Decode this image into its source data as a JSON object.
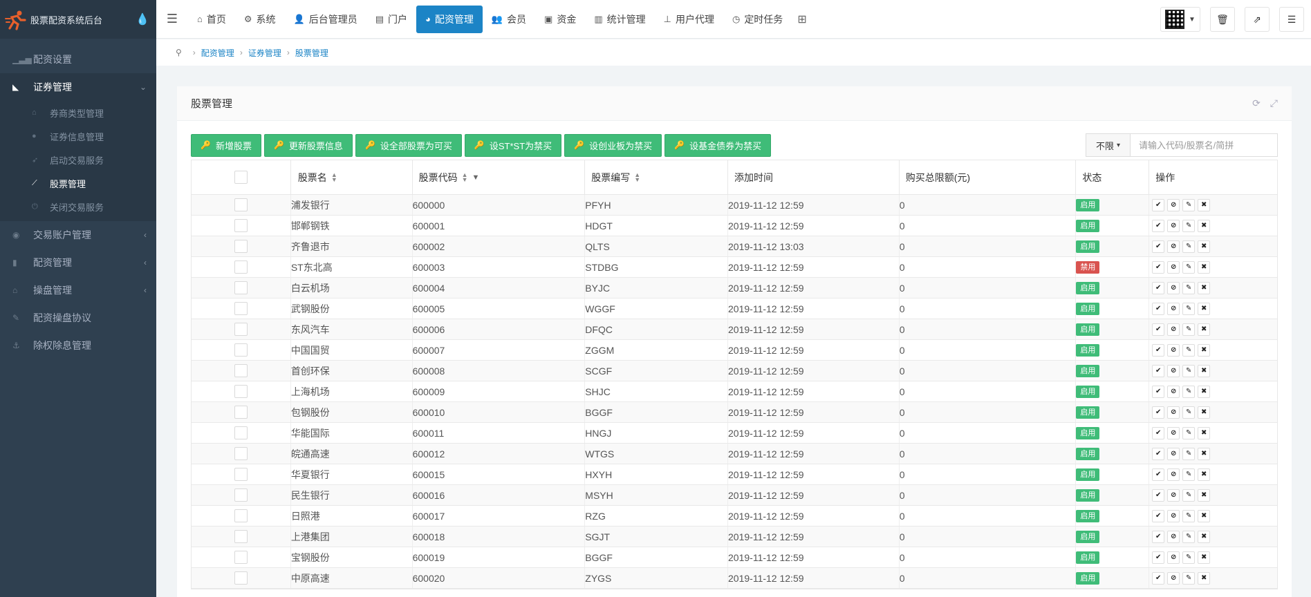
{
  "brand": {
    "title": "股票配资系统后台"
  },
  "sidebar": {
    "items": [
      {
        "label": "配资设置",
        "icon": "bar-chart-icon",
        "glyph": "▁▃▅"
      },
      {
        "label": "证券管理",
        "icon": "area-chart-icon",
        "glyph": "◣"
      },
      {
        "label": "交易账户管理",
        "icon": "user-circle-icon",
        "glyph": "◉"
      },
      {
        "label": "配资管理",
        "icon": "thermometer-icon",
        "glyph": "▮"
      },
      {
        "label": "操盘管理",
        "icon": "bank-icon",
        "glyph": "⌂"
      },
      {
        "label": "配资操盘协议",
        "icon": "pencil-icon",
        "glyph": "✎"
      },
      {
        "label": "除权除息管理",
        "icon": "anchor-icon",
        "glyph": "⚓"
      }
    ],
    "submenu": [
      {
        "label": "券商类型管理",
        "icon": "bank-icon",
        "glyph": "⌂"
      },
      {
        "label": "证券信息管理",
        "icon": "user-icon",
        "glyph": "●"
      },
      {
        "label": "启动交易服务",
        "icon": "rocket-icon",
        "glyph": "➶"
      },
      {
        "label": "股票管理",
        "icon": "line-chart-icon",
        "glyph": "⟋"
      },
      {
        "label": "关闭交易服务",
        "icon": "power-icon",
        "glyph": "⏻"
      }
    ]
  },
  "nav": {
    "tabs": [
      {
        "label": "首页",
        "icon": "home-icon",
        "glyph": "⌂"
      },
      {
        "label": "系统",
        "icon": "gear-icon",
        "glyph": "⚙"
      },
      {
        "label": "后台管理员",
        "icon": "user-icon",
        "glyph": "👤"
      },
      {
        "label": "门户",
        "icon": "newspaper-icon",
        "glyph": "▤"
      },
      {
        "label": "配资管理",
        "icon": "pie-chart-icon",
        "glyph": "◕"
      },
      {
        "label": "会员",
        "icon": "users-icon",
        "glyph": "👥"
      },
      {
        "label": "资金",
        "icon": "money-icon",
        "glyph": "▣"
      },
      {
        "label": "统计管理",
        "icon": "bar-chart-icon",
        "glyph": "▥"
      },
      {
        "label": "用户代理",
        "icon": "sitemap-icon",
        "glyph": "⊥"
      },
      {
        "label": "定时任务",
        "icon": "clock-icon",
        "glyph": "◷"
      }
    ]
  },
  "breadcrumb": {
    "items": [
      "配资管理",
      "证券管理",
      "股票管理"
    ]
  },
  "panel": {
    "title": "股票管理"
  },
  "toolbar": {
    "buttons": [
      "新增股票",
      "更新股票信息",
      "设全部股票为可买",
      "设ST*ST为禁买",
      "设创业板为禁买",
      "设基金债券为禁买"
    ],
    "filter_label": "不限",
    "search_placeholder": "请输入代码/股票名/简拼"
  },
  "table": {
    "headers": {
      "name": "股票名",
      "code": "股票代码",
      "abbr": "股票编写",
      "time": "添加时间",
      "limit": "购买总限额(元)",
      "status": "状态",
      "ops": "操作"
    },
    "rows": [
      {
        "name": "浦发银行",
        "code": "600000",
        "abbr": "PFYH",
        "time": "2019-11-12 12:59",
        "limit": "0",
        "status": "启用",
        "status_on": true
      },
      {
        "name": "邯郸钢铁",
        "code": "600001",
        "abbr": "HDGT",
        "time": "2019-11-12 12:59",
        "limit": "0",
        "status": "启用",
        "status_on": true
      },
      {
        "name": "齐鲁退市",
        "code": "600002",
        "abbr": "QLTS",
        "time": "2019-11-12 13:03",
        "limit": "0",
        "status": "启用",
        "status_on": true
      },
      {
        "name": "ST东北高",
        "code": "600003",
        "abbr": "STDBG",
        "time": "2019-11-12 12:59",
        "limit": "0",
        "status": "禁用",
        "status_on": false
      },
      {
        "name": "白云机场",
        "code": "600004",
        "abbr": "BYJC",
        "time": "2019-11-12 12:59",
        "limit": "0",
        "status": "启用",
        "status_on": true
      },
      {
        "name": "武钢股份",
        "code": "600005",
        "abbr": "WGGF",
        "time": "2019-11-12 12:59",
        "limit": "0",
        "status": "启用",
        "status_on": true
      },
      {
        "name": "东风汽车",
        "code": "600006",
        "abbr": "DFQC",
        "time": "2019-11-12 12:59",
        "limit": "0",
        "status": "启用",
        "status_on": true
      },
      {
        "name": "中国国贸",
        "code": "600007",
        "abbr": "ZGGM",
        "time": "2019-11-12 12:59",
        "limit": "0",
        "status": "启用",
        "status_on": true
      },
      {
        "name": "首创环保",
        "code": "600008",
        "abbr": "SCGF",
        "time": "2019-11-12 12:59",
        "limit": "0",
        "status": "启用",
        "status_on": true
      },
      {
        "name": "上海机场",
        "code": "600009",
        "abbr": "SHJC",
        "time": "2019-11-12 12:59",
        "limit": "0",
        "status": "启用",
        "status_on": true
      },
      {
        "name": "包钢股份",
        "code": "600010",
        "abbr": "BGGF",
        "time": "2019-11-12 12:59",
        "limit": "0",
        "status": "启用",
        "status_on": true
      },
      {
        "name": "华能国际",
        "code": "600011",
        "abbr": "HNGJ",
        "time": "2019-11-12 12:59",
        "limit": "0",
        "status": "启用",
        "status_on": true
      },
      {
        "name": "皖通高速",
        "code": "600012",
        "abbr": "WTGS",
        "time": "2019-11-12 12:59",
        "limit": "0",
        "status": "启用",
        "status_on": true
      },
      {
        "name": "华夏银行",
        "code": "600015",
        "abbr": "HXYH",
        "time": "2019-11-12 12:59",
        "limit": "0",
        "status": "启用",
        "status_on": true
      },
      {
        "name": "民生银行",
        "code": "600016",
        "abbr": "MSYH",
        "time": "2019-11-12 12:59",
        "limit": "0",
        "status": "启用",
        "status_on": true
      },
      {
        "name": "日照港",
        "code": "600017",
        "abbr": "RZG",
        "time": "2019-11-12 12:59",
        "limit": "0",
        "status": "启用",
        "status_on": true
      },
      {
        "name": "上港集团",
        "code": "600018",
        "abbr": "SGJT",
        "time": "2019-11-12 12:59",
        "limit": "0",
        "status": "启用",
        "status_on": true
      },
      {
        "name": "宝钢股份",
        "code": "600019",
        "abbr": "BGGF",
        "time": "2019-11-12 12:59",
        "limit": "0",
        "status": "启用",
        "status_on": true
      },
      {
        "name": "中原高速",
        "code": "600020",
        "abbr": "ZYGS",
        "time": "2019-11-12 12:59",
        "limit": "0",
        "status": "启用",
        "status_on": true
      }
    ]
  },
  "colors": {
    "sidebar": "#2f4050",
    "accent": "#1c84c6",
    "success": "#3fbc78",
    "danger": "#d9534f"
  }
}
